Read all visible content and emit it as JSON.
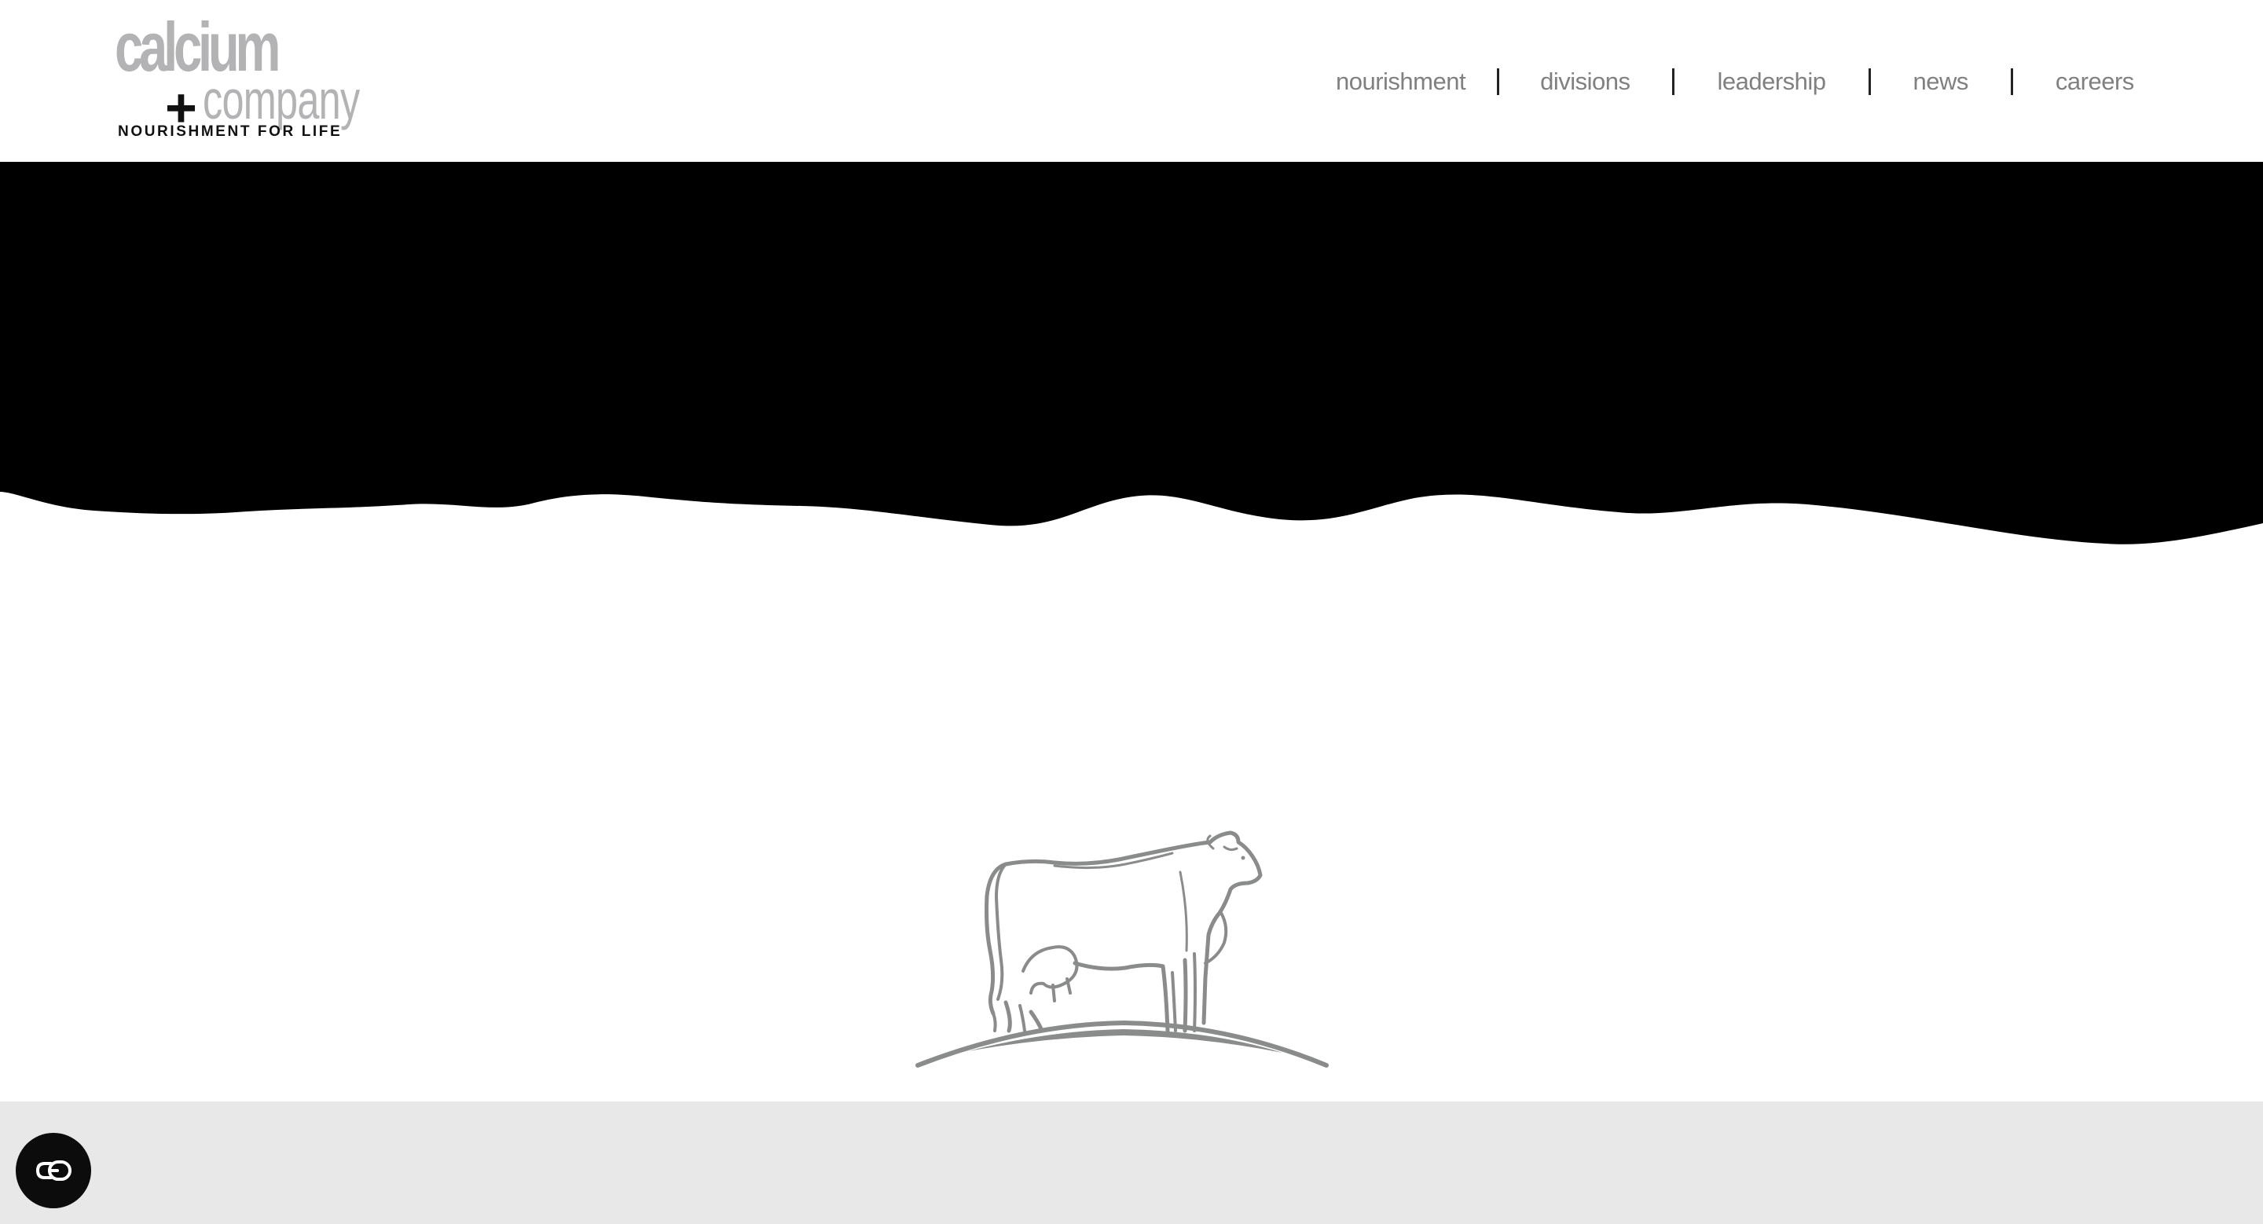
{
  "brand": {
    "name_line1": "calcium",
    "plus_symbol": "+",
    "name_line2": "company",
    "tagline": "NOURISHMENT FOR LIFE",
    "logo_gray": "#b3b3b6"
  },
  "nav": {
    "items": [
      {
        "label": "nourishment"
      },
      {
        "label": "divisions"
      },
      {
        "label": "leadership"
      },
      {
        "label": "news"
      },
      {
        "label": "careers"
      }
    ],
    "text_color": "#808083"
  },
  "hero": {
    "background": "#000000"
  },
  "illustration": {
    "icon": "cow-on-hill-icon",
    "stroke_color": "#8a8c8c"
  },
  "footer": {
    "background": "#e8e8e8"
  },
  "accessibility_button": {
    "icon": "accessibility-toggle-icon"
  }
}
